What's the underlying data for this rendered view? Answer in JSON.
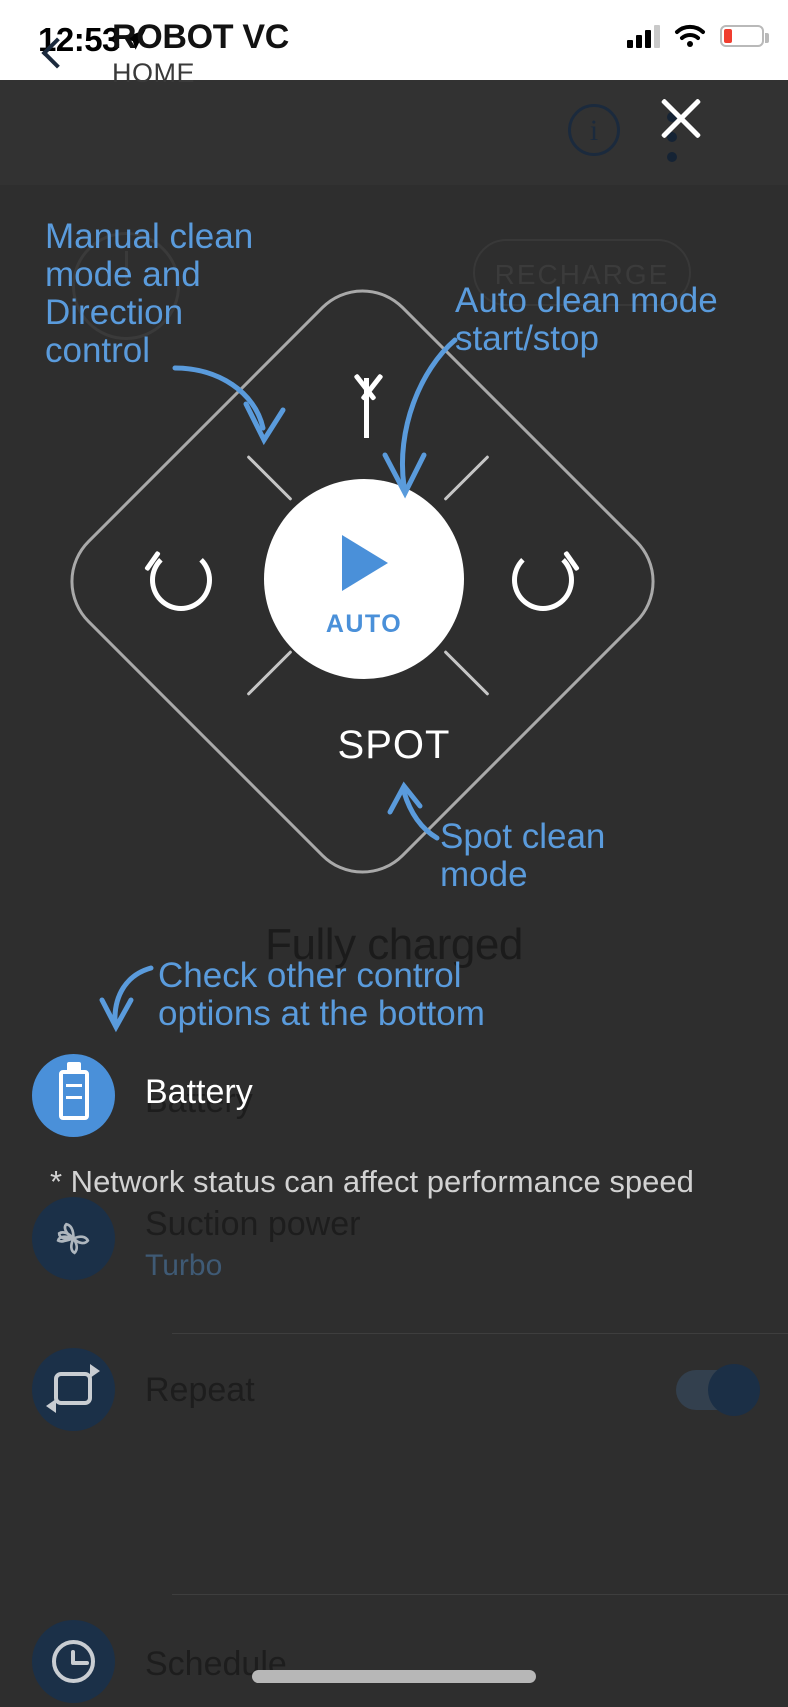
{
  "status_bar": {
    "time": "12:53",
    "location_icon": "location-arrow-icon",
    "signal_icon": "cellular-signal-icon",
    "wifi_icon": "wifi-icon",
    "battery_icon": "battery-low-icon"
  },
  "header": {
    "back_icon": "back-chevron-icon",
    "title": "ROBOT VC",
    "subtitle": "HOME",
    "info_icon": "info-icon",
    "info_glyph": "i",
    "menu_icon": "kebab-menu-icon",
    "close_icon": "close-x-icon"
  },
  "controls": {
    "power_label": "power-button-icon",
    "recharge_label": "RECHARGE",
    "up_arrow": "arrow-up-icon",
    "rotate_left": "rotate-left-icon",
    "rotate_right": "rotate-right-icon",
    "spot_label": "SPOT",
    "auto_label": "AUTO",
    "play_icon": "play-triangle-icon"
  },
  "status": {
    "charge_text": "Fully charged"
  },
  "list": {
    "battery": {
      "icon": "battery-icon",
      "label": "Battery",
      "label_overlay": "Battery"
    },
    "note": "* Network status can affect performance speed",
    "suction": {
      "icon": "fan-icon",
      "label": "Suction power",
      "value": "Turbo"
    },
    "repeat": {
      "icon": "repeat-icon",
      "label": "Repeat",
      "toggle_state": "on"
    },
    "schedule": {
      "icon": "clock-icon",
      "label": "Schedule"
    }
  },
  "annotations": {
    "accent_color": "#5a9bdc",
    "manual": "Manual clean mode and Direction control",
    "auto": "Auto clean mode start/stop",
    "spot": "Spot clean mode",
    "check_bottom": "Check other control options at the bottom"
  },
  "colors": {
    "background": "#2e2e2e",
    "header_bg": "#323232",
    "accent_blue": "#4a90d9",
    "annotation_blue": "#5a9bdc",
    "icon_circle_dark": "#1b3048"
  }
}
